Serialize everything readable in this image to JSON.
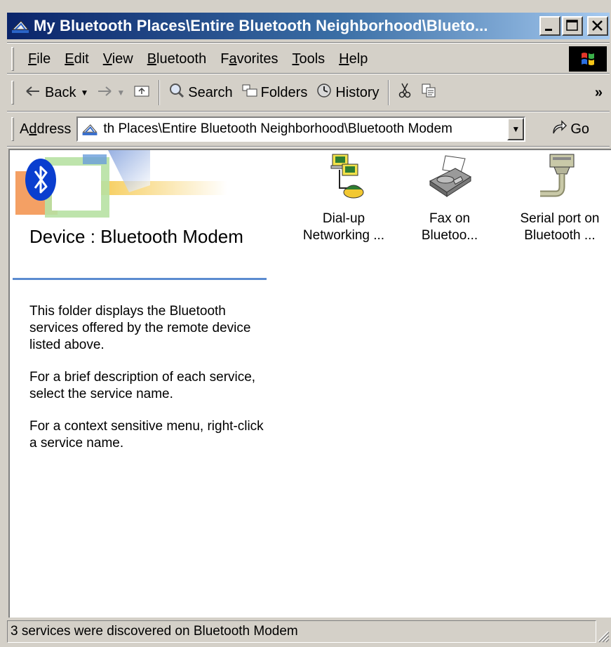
{
  "window": {
    "title": "My Bluetooth Places\\Entire Bluetooth Neighborhood\\Blueto...",
    "buttons": {
      "minimize": "_",
      "maximize": "□",
      "close": "✕"
    }
  },
  "menu": [
    {
      "label": "File",
      "accel": "F",
      "rest": "ile"
    },
    {
      "label": "Edit",
      "accel": "E",
      "rest": "dit"
    },
    {
      "label": "View",
      "accel": "V",
      "rest": "iew"
    },
    {
      "label": "Bluetooth",
      "accel": "B",
      "rest": "luetooth"
    },
    {
      "label": "Favorites",
      "pre": "F",
      "accel": "a",
      "rest": "vorites"
    },
    {
      "label": "Tools",
      "accel": "T",
      "rest": "ools"
    },
    {
      "label": "Help",
      "accel": "H",
      "rest": "elp"
    }
  ],
  "toolbar": {
    "back": "Back",
    "search": "Search",
    "folders": "Folders",
    "history": "History",
    "more": "»"
  },
  "address": {
    "label_pre": "A",
    "label_accel": "d",
    "label_rest": "dress",
    "value": "th Places\\Entire Bluetooth Neighborhood\\Bluetooth Modem",
    "go": "Go"
  },
  "panel": {
    "title": "Device : Bluetooth Modem",
    "paragraphs": [
      "This folder displays the Bluetooth services offered by the remote device listed above.",
      "For a brief description of each service, select the service name.",
      "For a context sensitive menu, right-click a service name."
    ]
  },
  "services": [
    {
      "line1": "Dial-up",
      "line2": "Networking ...",
      "icon": "dialup-networking-icon"
    },
    {
      "line1": "Fax on",
      "line2": "Bluetoo...",
      "icon": "fax-icon"
    },
    {
      "line1": "Serial port on",
      "line2": "Bluetooth ...",
      "icon": "serial-port-icon"
    }
  ],
  "status": {
    "text": "3 services were discovered on Bluetooth Modem"
  },
  "colors": {
    "titlebar_start": "#0a246a",
    "titlebar_end": "#a6caf0",
    "accent_rule": "#5b8bd0",
    "bluetooth_blue": "#0a3ecf"
  }
}
